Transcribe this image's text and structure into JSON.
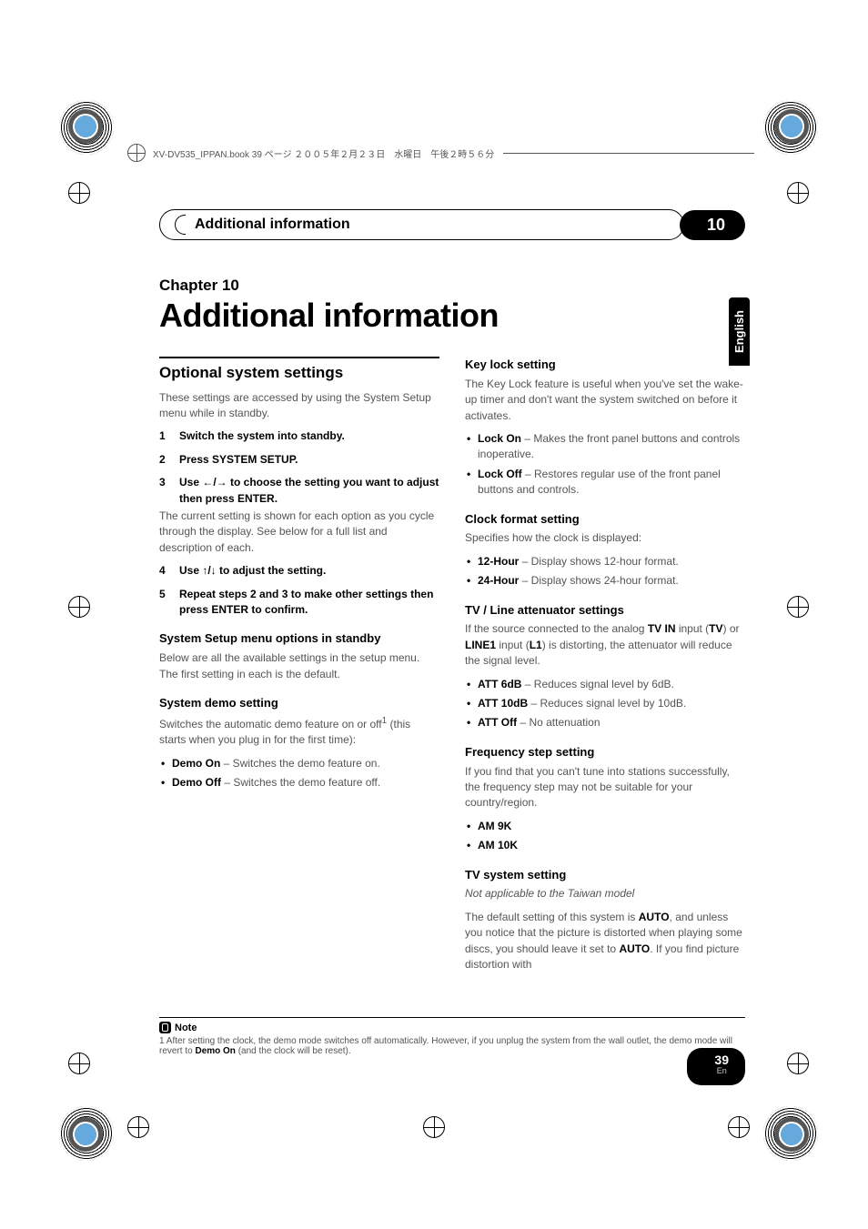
{
  "file_header": "XV-DV535_IPPAN.book  39 ページ  ２００５年２月２３日　水曜日　午後２時５６分",
  "chapter_bar_label": "Additional information",
  "chapter_bar_number": "10",
  "chapter_subtitle": "Chapter 10",
  "chapter_title": "Additional information",
  "language_tab": "English",
  "left_column": {
    "section_heading": "Optional system settings",
    "intro": "These settings are accessed by using the System Setup menu while in standby.",
    "steps": [
      {
        "num": "1",
        "text": "Switch the system into standby."
      },
      {
        "num": "2",
        "text": "Press SYSTEM SETUP."
      },
      {
        "num": "3",
        "text": "Use ←/→ to choose the setting you want to adjust then press ENTER."
      },
      {
        "num": "4",
        "text": "Use ↑/↓ to adjust the setting."
      },
      {
        "num": "5",
        "text": "Repeat steps 2 and 3 to make other settings then press ENTER to confirm."
      }
    ],
    "step3_desc": "The current setting is shown for each option as you cycle through the display. See below for a full list and description of each.",
    "sub1_heading": "System Setup menu options in standby",
    "sub1_text": "Below are all the available settings in the setup menu. The first setting in each is the default.",
    "sub2_heading": "System demo setting",
    "sub2_text_a": "Switches the automatic demo feature on or off",
    "sub2_footnote_marker": "1",
    "sub2_text_b": "(this starts when you plug in for the first time):",
    "sub2_items": [
      {
        "bold": "Demo On",
        "rest": " – Switches the demo feature on."
      },
      {
        "bold": "Demo Off",
        "rest": " – Switches the demo feature off."
      }
    ]
  },
  "right_column": {
    "keylock_heading": "Key lock setting",
    "keylock_text": "The Key Lock feature is useful when you've set the wake-up timer and don't want the system switched on before it activates.",
    "keylock_items": [
      {
        "bold": "Lock On",
        "rest": " – Makes the front panel buttons and controls inoperative."
      },
      {
        "bold": "Lock Off",
        "rest": " – Restores regular use of the front panel buttons and controls."
      }
    ],
    "clock_heading": "Clock format setting",
    "clock_text": "Specifies how the clock is displayed:",
    "clock_items": [
      {
        "bold": "12-Hour",
        "rest": " – Display shows 12-hour format."
      },
      {
        "bold": "24-Hour",
        "rest": " – Display shows 24-hour format."
      }
    ],
    "tvline_heading": "TV / Line attenuator settings",
    "tvline_text_a": "If the source connected to the analog ",
    "tvline_bold_a": "TV IN",
    "tvline_text_b": " input (",
    "tvline_bold_b": "TV",
    "tvline_text_c": ") or ",
    "tvline_bold_c": "LINE1",
    "tvline_text_d": " input (",
    "tvline_bold_d": "L1",
    "tvline_text_e": ") is distorting, the attenuator will reduce the signal level.",
    "tvline_items": [
      {
        "bold": "ATT 6dB",
        "rest": " – Reduces signal level by 6dB."
      },
      {
        "bold": "ATT 10dB",
        "rest": " – Reduces signal level by 10dB."
      },
      {
        "bold": "ATT Off",
        "rest": " – No attenuation"
      }
    ],
    "freq_heading": "Frequency step setting",
    "freq_text": "If you find that you can't tune into stations successfully, the frequency step may not be suitable for your country/region.",
    "freq_items": [
      {
        "bold": "AM 9K",
        "rest": ""
      },
      {
        "bold": "AM 10K",
        "rest": ""
      }
    ],
    "tvsys_heading": "TV system setting",
    "tvsys_italic": "Not applicable to the Taiwan model",
    "tvsys_text_a": "The default setting of this system is ",
    "tvsys_bold_a": "AUTO",
    "tvsys_text_b": ", and unless you notice that the picture is distorted when playing some discs, you should leave it set to ",
    "tvsys_bold_b": "AUTO",
    "tvsys_text_c": ". If you find picture distortion with"
  },
  "note": {
    "label": "Note",
    "text_a": "1 After setting the clock, the demo mode switches off automatically. However, if you unplug the system from the wall outlet, the demo mode will revert to ",
    "bold": "Demo On",
    "text_b": " (and the clock will be reset)."
  },
  "page_number": "39",
  "page_lang": "En"
}
